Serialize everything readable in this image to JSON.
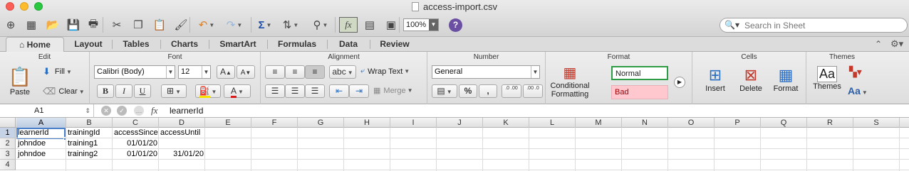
{
  "window": {
    "title": "access-import.csv",
    "search_placeholder": "Search in Sheet",
    "zoom": "100%",
    "help": "?"
  },
  "toolbar": [
    {
      "name": "new-icon",
      "glyph": "⊕"
    },
    {
      "name": "templates-icon",
      "glyph": "▦"
    },
    {
      "name": "open-icon",
      "glyph": "📂"
    },
    {
      "name": "save-icon",
      "glyph": "💾"
    },
    {
      "name": "print-icon",
      "glyph": "🖶"
    },
    {
      "name": "cut-icon",
      "glyph": "✂"
    },
    {
      "name": "copy-icon",
      "glyph": "❐"
    },
    {
      "name": "paste-icon",
      "glyph": "📋"
    },
    {
      "name": "format-painter-icon",
      "glyph": "🖌"
    },
    {
      "name": "undo-icon",
      "glyph": "↶"
    },
    {
      "name": "redo-icon",
      "glyph": "↷"
    },
    {
      "name": "autosum-icon",
      "glyph": "Σ"
    },
    {
      "name": "sort-icon",
      "glyph": "⇅"
    },
    {
      "name": "filter-icon",
      "glyph": "⚲"
    },
    {
      "name": "formula-builder-icon",
      "glyph": "fx"
    },
    {
      "name": "gallery-icon",
      "glyph": "▤"
    },
    {
      "name": "media-icon",
      "glyph": "▣"
    }
  ],
  "tabs": [
    "Home",
    "Layout",
    "Tables",
    "Charts",
    "SmartArt",
    "Formulas",
    "Data",
    "Review"
  ],
  "ribbon": {
    "groups": {
      "edit": "Edit",
      "font": "Font",
      "alignment": "Alignment",
      "number": "Number",
      "format": "Format",
      "cells": "Cells",
      "themes": "Themes"
    },
    "paste": "Paste",
    "fill": "Fill",
    "clear": "Clear",
    "font_name": "Calibri (Body)",
    "font_size": "12",
    "bold": "B",
    "italic": "I",
    "underline": "U",
    "grow_font": "A",
    "shrink_font": "A",
    "wrap_text": "Wrap Text",
    "merge": "Merge",
    "abc": "abc",
    "number_format": "General",
    "percent": "%",
    "comma": ",",
    "inc_decimal": ".0 .00",
    "dec_decimal": ".00 .0",
    "conditional_formatting_1": "Conditional",
    "conditional_formatting_2": "Formatting",
    "style_normal": "Normal",
    "style_bad": "Bad",
    "insert": "Insert",
    "delete": "Delete",
    "format": "Format",
    "themes": "Themes",
    "theme_fonts": "Aa"
  },
  "formula_bar": {
    "cell_ref": "A1",
    "fx": "fx",
    "content": "learnerId"
  },
  "sheet": {
    "columns": [
      "A",
      "B",
      "C",
      "D",
      "E",
      "F",
      "G",
      "H",
      "I",
      "J",
      "K",
      "L",
      "M",
      "N",
      "O",
      "P",
      "Q",
      "R",
      "S"
    ],
    "rows": [
      "1",
      "2",
      "3",
      "4"
    ],
    "cells": [
      [
        "learnerId",
        "trainingId",
        "accessSince",
        "accessUntil"
      ],
      [
        "johndoe",
        "training1",
        "01/01/20",
        ""
      ],
      [
        "johndoe",
        "training2",
        "01/01/20",
        "31/01/20"
      ],
      [
        "",
        "",
        "",
        ""
      ]
    ],
    "active_cell": "A1"
  },
  "colors": {
    "accent": "#4a7fc9",
    "style_normal_border": "#2e9b45",
    "style_bad_bg": "#ffc7ce",
    "style_bad_text": "#9c0006"
  }
}
